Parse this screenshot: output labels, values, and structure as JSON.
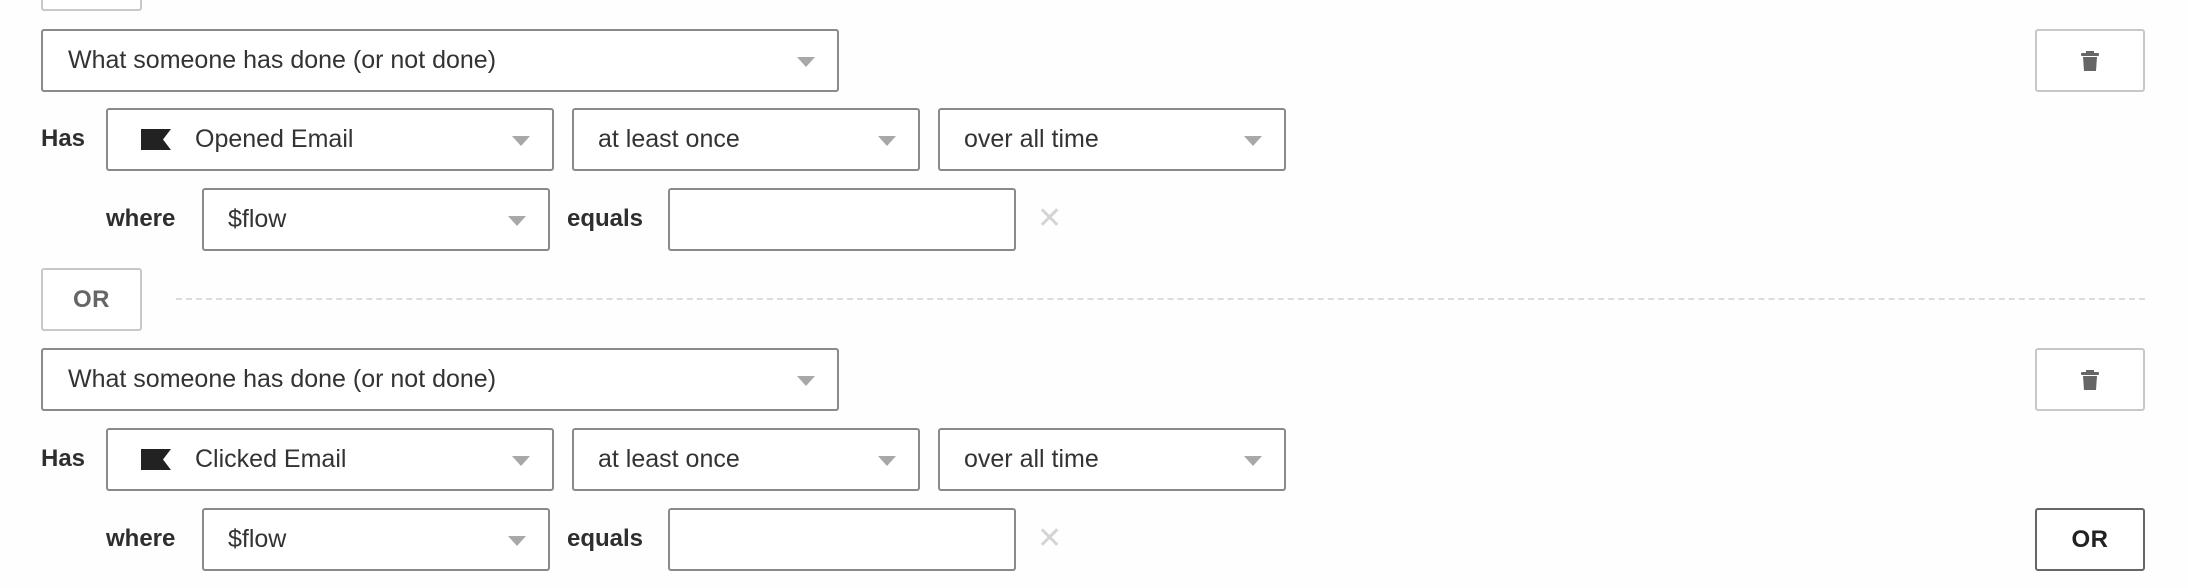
{
  "conditions": [
    {
      "type_select": "What someone has done (or not done)",
      "has_label": "Has",
      "event_icon": "flag-icon",
      "event_select": "Opened Email",
      "frequency_select": "at least once",
      "timeframe_select": "over all time",
      "where_label": "where",
      "property_select": "$flow",
      "operator_label": "equals",
      "value_input": "",
      "delete_icon": "trash-icon",
      "remove_filter_icon": "x-icon"
    },
    {
      "type_select": "What someone has done (or not done)",
      "has_label": "Has",
      "event_icon": "flag-icon",
      "event_select": "Clicked Email",
      "frequency_select": "at least once",
      "timeframe_select": "over all time",
      "where_label": "where",
      "property_select": "$flow",
      "operator_label": "equals",
      "value_input": "",
      "delete_icon": "trash-icon",
      "remove_filter_icon": "x-icon"
    }
  ],
  "separator": {
    "or_label": "OR"
  },
  "footer": {
    "add_or_label": "OR"
  },
  "icons": {
    "remove_filter_glyph": "✕"
  },
  "colors": {
    "border": "#8a8a8a",
    "light_border": "#c8c8c8",
    "text": "#333333",
    "icon": "#666666",
    "caret": "#a8a8a8"
  }
}
